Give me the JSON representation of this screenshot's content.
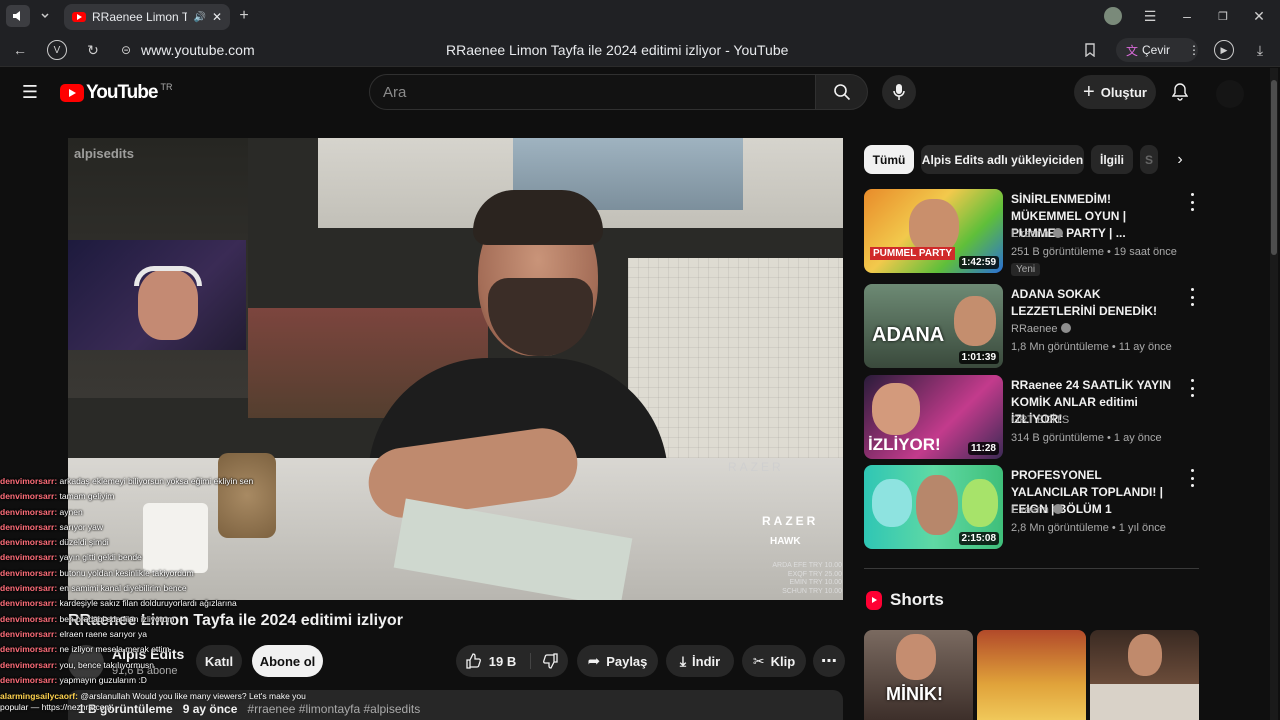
{
  "browser": {
    "tab_title": "RRaenee Limon Tayf",
    "url": "www.youtube.com",
    "page_title": "RRaenee Limon Tayfa ile 2024 editimi izliyor - YouTube",
    "translate_label": "Çevir"
  },
  "header": {
    "logo_text": "YouTube",
    "region": "TR",
    "search_placeholder": "Ara",
    "create_label": "Oluştur"
  },
  "video": {
    "watermark": "alpisedits",
    "title": "RRaenee Limon Tayfa ile 2024 editimi izliyor",
    "channel": "Alpis Edits",
    "subscribers": "91,6 B abone",
    "join_label": "Katıl",
    "subscribe_label": "Abone ol",
    "likes": "19 B",
    "share_label": "Paylaş",
    "download_label": "İndir",
    "clip_label": "Klip",
    "views": "1 B görüntüleme",
    "age": "9 ay önce",
    "tags": "#rraenee #limontayfa #alpisedits",
    "overlay_razer": "RAZER",
    "overlay_hawk": "HAWK",
    "overlay_donations": [
      "ARDA EFE TRY 10.00",
      "EXQF TRY 25.00",
      "EMIN TRY 10.00",
      "SCHUN TRY 10.00"
    ]
  },
  "chat": [
    {
      "user": "denvimorsarr:",
      "text": "arkadaş eklemeyi biliyorsun yoksa eğimi ekliyin sen"
    },
    {
      "user": "denvimorsarr:",
      "text": "tamam geliyim"
    },
    {
      "user": "denvimorsarr:",
      "text": "aynen"
    },
    {
      "user": "denvimorsarr:",
      "text": "sarıyor yaw"
    },
    {
      "user": "denvimorsarr:",
      "text": "düzeldi şimdi"
    },
    {
      "user": "denvimorsarr:",
      "text": "yayın gitti geldi bende"
    },
    {
      "user": "denvimorsarr:",
      "text": "butonu yoldan kesinlikle takiyordum"
    },
    {
      "user": "denvimorsarr:",
      "text": "en samimi kanal diyebilirim bence"
    },
    {
      "user": "denvimorsarr:",
      "text": "kardeşiyle sakız filan dolduruyorlardı ağızlarına"
    },
    {
      "user": "denvimorsarr:",
      "text": "ben oradabi sda filan izliyorum"
    },
    {
      "user": "denvimorsarr:",
      "text": "elraen raene sarıyor ya"
    },
    {
      "user": "denvimorsarr:",
      "text": "ne izliyor mesela merak ettim"
    },
    {
      "user": "denvimorsarr:",
      "text": "you, bence takılıyormusn"
    },
    {
      "user": "denvimorsarr:",
      "text": "yapmayın guzularım :D"
    }
  ],
  "chat_promo": {
    "user": "alarmingsailycaorf:",
    "text": "@arslanullah Would you like many viewers? Let's make you popular — https://nezhra.com"
  },
  "chips": [
    "Tümü",
    "Alpis Edits adlı yükleyiciden",
    "İlgili",
    "S"
  ],
  "recommendations": [
    {
      "title": "SİNİRLENMEDİM! MÜKEMMEL OYUN | PUMMEL PARTY | ...",
      "channel": "Elraenn",
      "meta": "251 B görüntüleme • 19 saat önce",
      "badge": "Yeni",
      "duration": "1:42:59",
      "thumb_text": "PUMMEL PARTY"
    },
    {
      "title": "ADANA SOKAK LEZZETLERİNİ DENEDİK!",
      "channel": "RRaenee",
      "meta": "1,8 Mn görüntüleme • 11 ay önce",
      "badge": "",
      "duration": "1:01:39",
      "thumb_text": "ADANA"
    },
    {
      "title": "RRaenee 24 SAATLİK YAYIN KOMİK ANLAR editimi İZLİYOR!",
      "channel": "GRT EDİTS",
      "meta": "314 B görüntüleme • 1 ay önce",
      "badge": "",
      "duration": "11:28",
      "thumb_text": "İZLİYOR!"
    },
    {
      "title": "PROFESYONEL YALANCILAR TOPLANDI! | FEIGN | BÖLÜM 1",
      "channel": "Elraenn",
      "meta": "2,8 Mn görüntüleme • 1 yıl önce",
      "badge": "",
      "duration": "2:15:08",
      "thumb_text": ""
    }
  ],
  "shorts": {
    "label": "Shorts",
    "items": [
      {
        "text": "MİNİK!"
      },
      {
        "text": ""
      },
      {
        "text": ""
      }
    ]
  },
  "colors": {
    "bg": "#0f0f0f",
    "chip": "#272727",
    "brand": "#ff0000",
    "chat_user": "#ff6e7a"
  }
}
